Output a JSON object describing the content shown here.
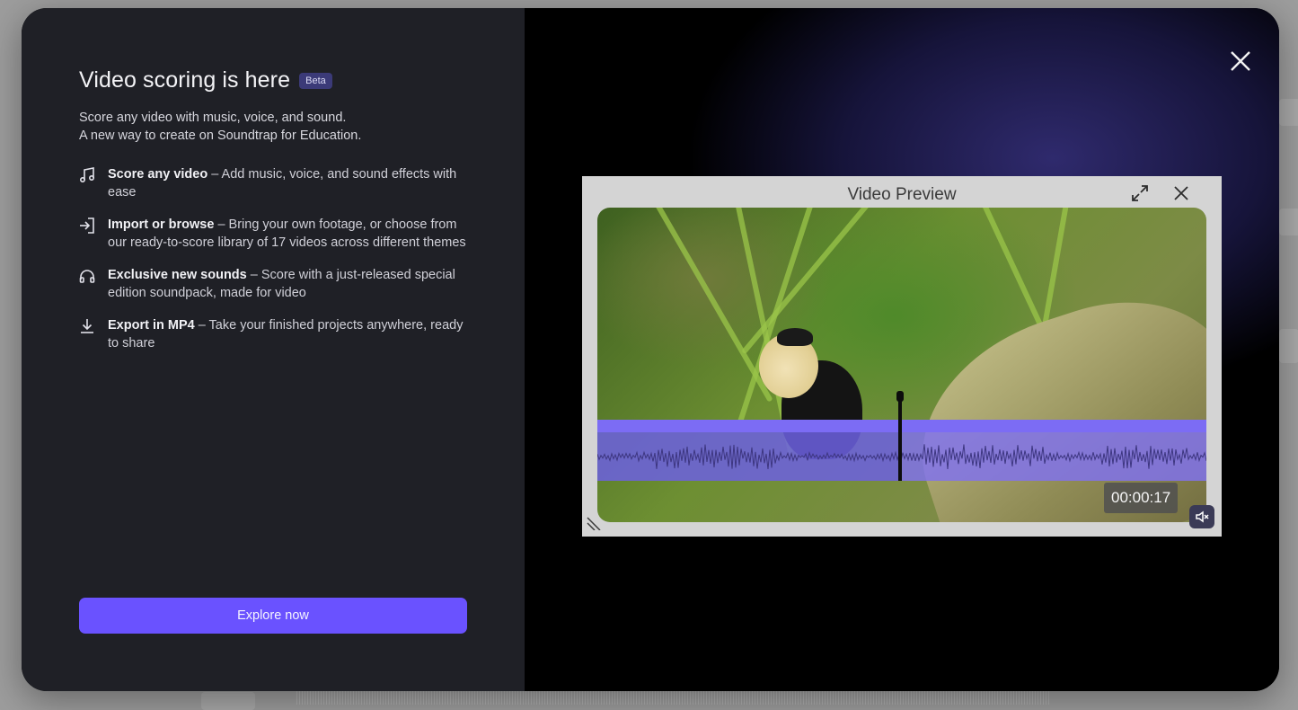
{
  "modal": {
    "title": "Video scoring is here",
    "badge": "Beta",
    "intro_line1": "Score any video with music, voice, and sound.",
    "intro_line2": "A new way to create on Soundtrap for Education.",
    "features": [
      {
        "icon": "music-note-icon",
        "title": "Score any video",
        "text": " – Add music, voice, and sound effects with ease"
      },
      {
        "icon": "import-icon",
        "title": "Import or browse",
        "text": " – Bring your own footage, or choose from our ready-to-score library of 17 videos across different themes"
      },
      {
        "icon": "headphones-icon",
        "title": "Exclusive new sounds",
        "text": " – Score with a just-released special edition soundpack, made for video"
      },
      {
        "icon": "download-icon",
        "title": "Export in MP4",
        "text": " – Take your finished projects anywhere, ready to share"
      }
    ],
    "cta_label": "Explore now"
  },
  "preview": {
    "title": "Video Preview",
    "timecode": "00:00:17"
  },
  "colors": {
    "accent": "#6a52ff",
    "panel": "#1f2026",
    "badge_bg": "#3b3a78",
    "waveform": "#7c6cf4"
  }
}
